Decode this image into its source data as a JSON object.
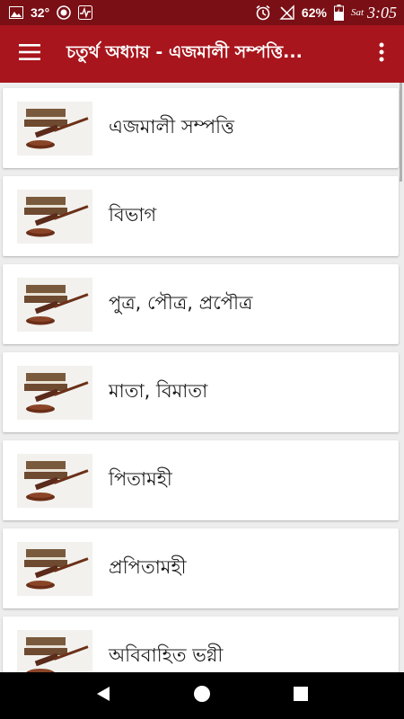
{
  "status_bar": {
    "temperature": "32°",
    "battery": "62%",
    "day": "Sat",
    "time": "3:05",
    "icons": [
      "image-icon",
      "circle-record-icon",
      "activity-icon",
      "alarm-icon",
      "signal-off-icon",
      "battery-charging-icon"
    ]
  },
  "app_bar": {
    "title": "চতুর্থ অধ্যায় - এজমালী সম্পত্তি...",
    "menu_icon": "hamburger-menu-icon",
    "overflow_icon": "more-vert-icon"
  },
  "list": {
    "items": [
      {
        "label": "এজমালী সম্পত্তি"
      },
      {
        "label": "বিভাগ"
      },
      {
        "label": "পুত্র, পৌত্র, প্রপৌত্র"
      },
      {
        "label": "মাতা, বিমাতা"
      },
      {
        "label": "পিতামহী"
      },
      {
        "label": "প্রপিতামহী"
      },
      {
        "label": "অবিবাহিত ভগ্নী"
      }
    ]
  },
  "nav_bar": {
    "icons": [
      "back-icon",
      "home-icon",
      "recents-icon"
    ]
  },
  "colors": {
    "status_bar": "#7a0f15",
    "app_bar": "#a8151c",
    "background": "#ededed"
  }
}
